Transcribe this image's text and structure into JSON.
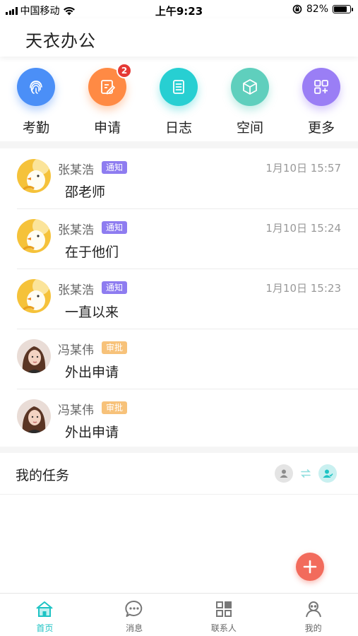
{
  "status_bar": {
    "carrier": "中国移动",
    "time": "上午9:23",
    "battery": "82%",
    "battery_level": 0.82
  },
  "header": {
    "title": "天衣办公"
  },
  "quick_apps": [
    {
      "label": "考勤",
      "icon": "fingerprint-icon",
      "color": "#4b8ff7",
      "badge": ""
    },
    {
      "label": "申请",
      "icon": "edit-form-icon",
      "color": "#ff8a44",
      "badge": "2"
    },
    {
      "label": "日志",
      "icon": "document-icon",
      "color": "#27cfd2",
      "badge": ""
    },
    {
      "label": "空间",
      "icon": "cube-icon",
      "color": "#5fcfbd",
      "badge": ""
    },
    {
      "label": "更多",
      "icon": "grid-icon",
      "color": "#9a7ef5",
      "badge": ""
    }
  ],
  "messages": [
    {
      "name": "张某浩",
      "tag": "通知",
      "tag_color": "#8e7cf0",
      "time": "1月10日 15:57",
      "text": "邵老师",
      "avatar": "chick-avatar"
    },
    {
      "name": "张某浩",
      "tag": "通知",
      "tag_color": "#8e7cf0",
      "time": "1月10日 15:24",
      "text": "在于他们",
      "avatar": "chick-avatar"
    },
    {
      "name": "张某浩",
      "tag": "通知",
      "tag_color": "#8e7cf0",
      "time": "1月10日 15:23",
      "text": "一直以来",
      "avatar": "chick-avatar"
    },
    {
      "name": "冯某伟",
      "tag": "审批",
      "tag_color": "#f7c27a",
      "time": "",
      "text": "外出申请",
      "avatar": "woman-avatar"
    },
    {
      "name": "冯某伟",
      "tag": "审批",
      "tag_color": "#f7c27a",
      "time": "",
      "text": "外出申请",
      "avatar": "woman-avatar"
    }
  ],
  "tasks": {
    "title": "我的任务"
  },
  "tabs": [
    {
      "label": "首页",
      "icon": "home-icon",
      "active": true
    },
    {
      "label": "消息",
      "icon": "chat-bubble-icon",
      "active": false
    },
    {
      "label": "联系人",
      "icon": "contacts-grid-icon",
      "active": false
    },
    {
      "label": "我的",
      "icon": "user-icon",
      "active": false
    }
  ],
  "colors": {
    "accent": "#1ec3c4",
    "fab": "#f26b5c"
  }
}
